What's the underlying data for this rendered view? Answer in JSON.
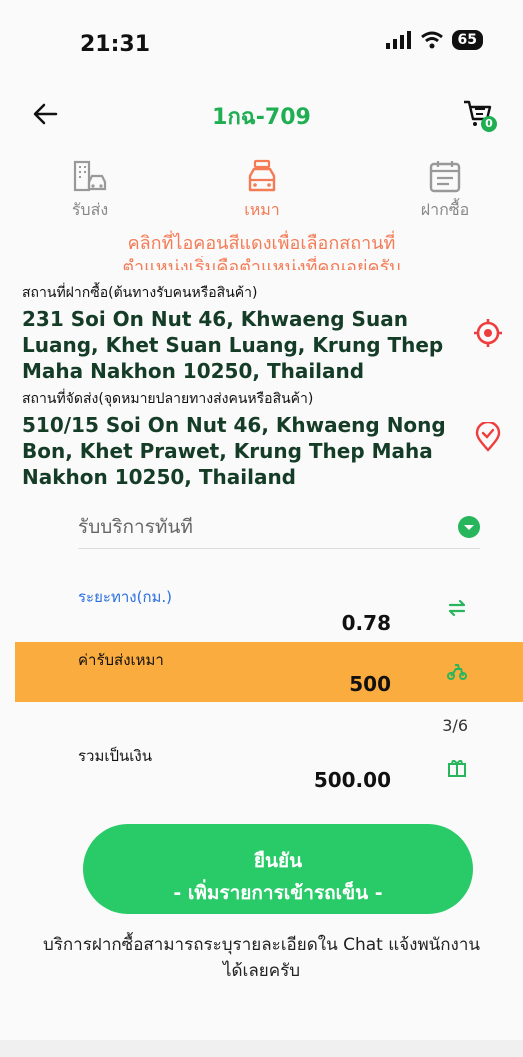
{
  "status_bar": {
    "time": "21:31",
    "battery": "65"
  },
  "header": {
    "title": "1กฉ-709",
    "cart_badge": "0"
  },
  "modes": [
    {
      "label": "รับส่ง",
      "icon": "building-car-icon",
      "active": false
    },
    {
      "label": "เหมา",
      "icon": "taxi-icon",
      "active": true
    },
    {
      "label": "ฝากซื้อ",
      "icon": "calendar-icon",
      "active": false
    }
  ],
  "hint": {
    "line1": "คลิกที่ไอคอนสีแดงเพื่อเลือกสถานที่",
    "line2": "ตำแหน่งเริ่มคือตำแหน่งที่คุณอยู่ครับ"
  },
  "pickup": {
    "label": "สถานที่ฝากซื้อ(ต้นทางรับคนหรือสินค้า)",
    "address": "231 Soi On Nut 46, Khwaeng Suan Luang, Khet Suan Luang, Krung Thep Maha Nakhon 10250, Thailand",
    "icon": "target-pin-icon"
  },
  "dropoff": {
    "label": "สถานที่จัดส่ง(จุดหมายปลายทางส่งคนหรือสินค้า)",
    "address": "510/15 Soi On Nut 46, Khwaeng Nong Bon, Khet Prawet, Krung Thep Maha Nakhon 10250, Thailand",
    "icon": "location-check-icon"
  },
  "service": {
    "value": "รับบริการทันที"
  },
  "distance": {
    "label": "ระยะทาง(กม.)",
    "value": "0.78"
  },
  "fare": {
    "label": "ค่ารับส่งเหมา",
    "value": "500"
  },
  "counter": "3/6",
  "total": {
    "label": "รวมเป็นเงิน",
    "value": "500.00"
  },
  "confirm_button": {
    "line1": "ยืนยัน",
    "line2": "- เพิ่มรายการเข้ารถเข็น -"
  },
  "footer_note": "บริการฝากซื้อสามารถระบุรายละเอียดใน Chat แจ้งพนักงานได้เลยครับ",
  "colors": {
    "brand_green": "#1fae52",
    "accent_orange": "#f47b55",
    "fare_bg": "#fbac3e",
    "button_green": "#28cb67"
  }
}
